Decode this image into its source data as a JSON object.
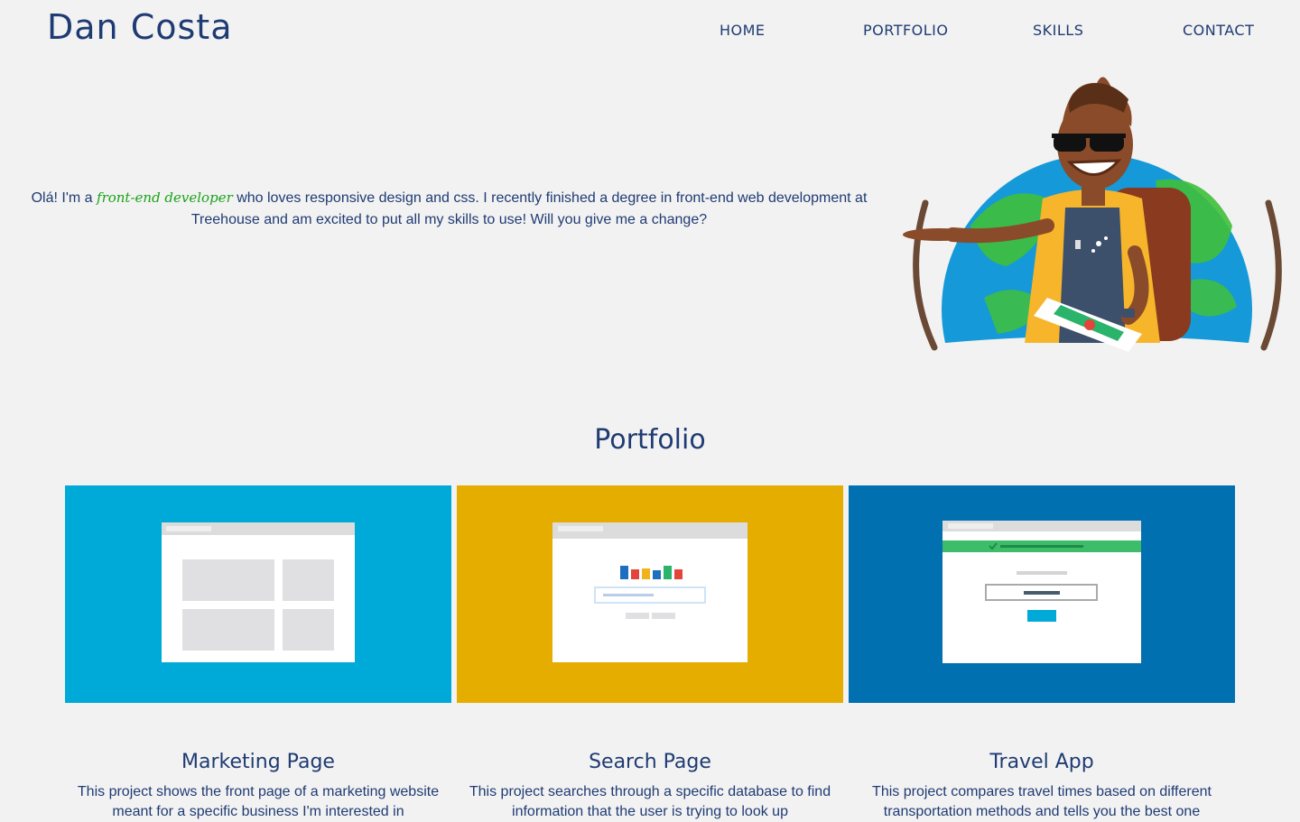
{
  "header": {
    "brand": "Dan Costa",
    "nav": [
      "HOME",
      "PORTFOLIO",
      "SKILLS",
      "CONTACT"
    ]
  },
  "intro": {
    "before": "Olá! I'm a ",
    "accent": "front-end developer",
    "after": " who loves responsive design and css. I recently finished a degree in front-end web development at Treehouse and am excited to put all my skills to use! Will you give me a change?"
  },
  "portfolio": {
    "title": "Portfolio",
    "projects": [
      {
        "title": "Marketing Page",
        "description": "This project shows the front page of a marketing website meant for a specific business I'm interested in",
        "bg_color": "#00aad8"
      },
      {
        "title": "Search Page",
        "description": "This project searches through a specific database to find information that the user is trying to look up",
        "bg_color": "#e5ad00"
      },
      {
        "title": "Travel App",
        "description": "This project compares travel times based on different transportation methods and tells you the best one",
        "bg_color": "#0070b0"
      }
    ]
  },
  "colors": {
    "text": "#1f3b73",
    "accent": "#1aa31a",
    "background": "#f2f2f2"
  }
}
